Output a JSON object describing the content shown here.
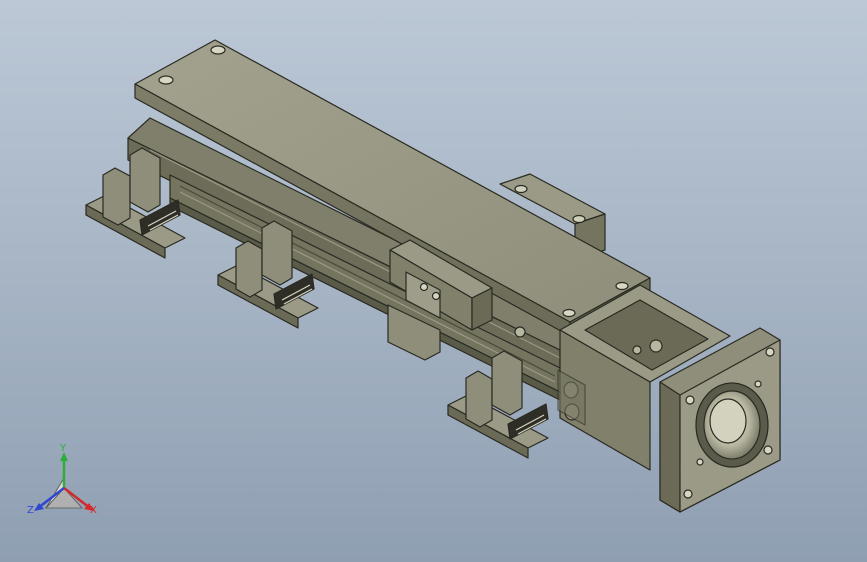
{
  "viewport": {
    "background_top": "#bcc8d6",
    "background_bottom": "#8f9fb2"
  },
  "model": {
    "body_color": "#8a8a74",
    "top_face_color": "#9a9a86",
    "dark_color": "#5b5b4c",
    "edge_color": "#2a2a22",
    "bore_color": "#c9c9b4"
  },
  "triad": {
    "x_label": "X",
    "y_label": "Y",
    "z_label": "Z",
    "x_color": "#d42a2a",
    "y_color": "#2fae3a",
    "z_color": "#2f47d0"
  }
}
